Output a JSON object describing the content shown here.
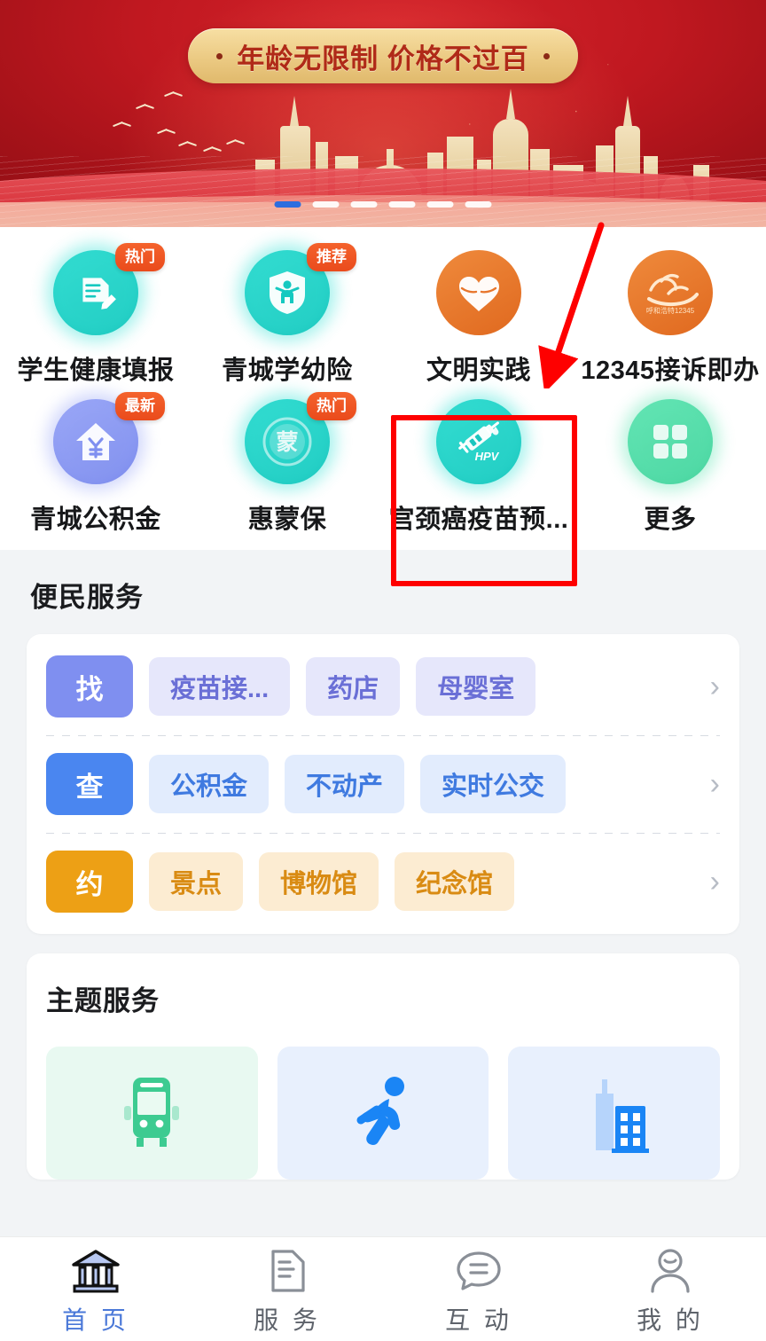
{
  "banner": {
    "slogan": "年龄无限制 价格不过百",
    "dot_left": "•",
    "dot_right": "•",
    "pagination": {
      "total": 6,
      "active_index": 0,
      "active_color": "#2b6ddf",
      "inactive_color": "#ffffff"
    }
  },
  "quick_grid": {
    "rows": [
      [
        {
          "label": "学生健康填报",
          "badge": "热门",
          "icon": "health-report-icon",
          "color": "#15c9c0"
        },
        {
          "label": "青城学幼险",
          "badge": "推荐",
          "icon": "child-insurance-shield-icon",
          "color": "#15c9c0"
        },
        {
          "label": "文明实践",
          "badge": "",
          "icon": "civilization-heart-icon",
          "color": "#e8762c"
        },
        {
          "label": "12345接诉即办",
          "badge": "",
          "icon": "hotline-12345-icon",
          "color": "#e8762c",
          "emblem_text": "呼和浩特12345"
        }
      ],
      [
        {
          "label": "青城公积金",
          "badge": "最新",
          "icon": "housing-fund-icon",
          "color": "#7f8ff0"
        },
        {
          "label": "惠蒙保",
          "badge": "热门",
          "icon": "huimengbao-icon",
          "color": "#15c9c0",
          "emblem_text": "蒙"
        },
        {
          "label": "宫颈癌疫苗预...",
          "badge": "",
          "icon": "hpv-vaccine-icon",
          "color": "#15c9c0",
          "emblem_text": "HPV"
        },
        {
          "label": "更多",
          "badge": "",
          "icon": "more-grid-icon",
          "color": "#4ed9a4"
        }
      ]
    ]
  },
  "bianmin": {
    "title": "便民服务",
    "rows": [
      {
        "key": "找",
        "key_bg": "#7f8ff0",
        "tag_bg": "#e6e7fb",
        "tag_color": "#6a6fd6",
        "tags": [
          "疫苗接...",
          "药店",
          "母婴室"
        ],
        "chevron": "›"
      },
      {
        "key": "查",
        "key_bg": "#4a86f0",
        "tag_bg": "#e2ecfd",
        "tag_color": "#3f7ae0",
        "tags": [
          "公积金",
          "不动产",
          "实时公交"
        ],
        "chevron": "›"
      },
      {
        "key": "约",
        "key_bg": "#eda015",
        "tag_bg": "#fcecd2",
        "tag_color": "#d98b13",
        "tags": [
          "景点",
          "博物馆",
          "纪念馆"
        ],
        "chevron": "›"
      }
    ]
  },
  "theme": {
    "title": "主题服务",
    "tiles": [
      {
        "icon": "bus-icon",
        "bg": "#e8f9f1",
        "color": "#3dcb91"
      },
      {
        "icon": "running-icon",
        "bg": "#e8f0fd",
        "color": "#1a85f5"
      },
      {
        "icon": "building-icon",
        "bg": "#e8f0fd",
        "color": "#1a85f5"
      }
    ]
  },
  "tabbar": {
    "items": [
      {
        "label": "首 页",
        "icon": "government-building-icon",
        "active": true
      },
      {
        "label": "服 务",
        "icon": "document-icon",
        "active": false
      },
      {
        "label": "互 动",
        "icon": "chat-bubble-icon",
        "active": false
      },
      {
        "label": "我 的",
        "icon": "person-icon",
        "active": false
      }
    ],
    "active_color": "#4a78d8",
    "inactive_color": "#8a8f97"
  },
  "annotations": {
    "highlight_box": {
      "target": "宫颈癌疫苗预...",
      "color": "#fe0000"
    },
    "arrow": {
      "points_to": "文明实践",
      "color": "#fe0000"
    }
  }
}
